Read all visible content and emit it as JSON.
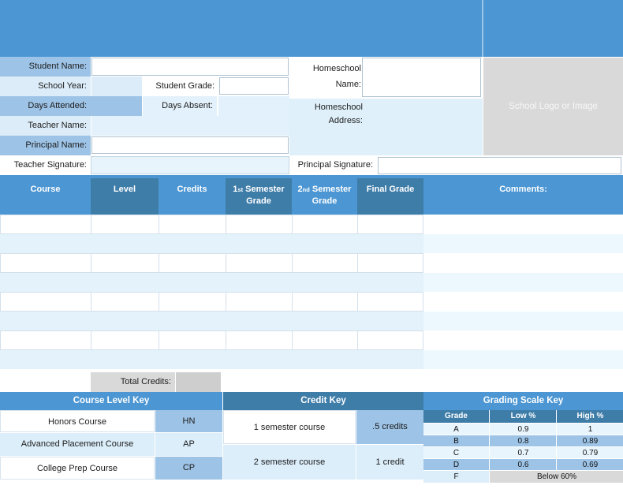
{
  "info": {
    "student_name": {
      "label": "Student Name:",
      "value": ""
    },
    "school_year": {
      "label": "School Year:",
      "value": ""
    },
    "student_grade": {
      "label": "Student Grade:",
      "value": ""
    },
    "days_attended": {
      "label": "Days Attended:",
      "value": ""
    },
    "days_absent": {
      "label": "Days Absent:",
      "value": ""
    },
    "teacher_name": {
      "label": "Teacher Name:",
      "value": ""
    },
    "principal_name": {
      "label": "Principal Name:",
      "value": ""
    },
    "teacher_signature": {
      "label": "Teacher Signature:",
      "value": ""
    },
    "homeschool_name": {
      "label": "Homeschool Name:",
      "value": ""
    },
    "homeschool_address": {
      "label": "Homeschool Address:",
      "value": ""
    },
    "principal_signature": {
      "label": "Principal Signature:",
      "value": ""
    },
    "logo_placeholder": "School Logo or Image"
  },
  "course_table": {
    "headers": {
      "course": "Course",
      "level": "Level",
      "credits": "Credits",
      "sem1": {
        "num": "1",
        "ord": "st",
        "rest": " Semester Grade"
      },
      "sem2": {
        "num": "2",
        "ord": "nd",
        "rest": " Semester Grade"
      },
      "final": "Final Grade",
      "comments": "Comments:"
    },
    "empty_row_count": 8,
    "total_credits": {
      "label": "Total Credits:",
      "value": ""
    }
  },
  "keys": {
    "course_level": {
      "title": "Course Level Key",
      "rows": [
        {
          "name": "Honors Course",
          "code": "HN"
        },
        {
          "name": "Advanced Placement Course",
          "code": "AP"
        },
        {
          "name": "College Prep Course",
          "code": "CP"
        }
      ]
    },
    "credit": {
      "title": "Credit Key",
      "rows": [
        {
          "name": "1 semester course",
          "value": ".5 credits"
        },
        {
          "name": "2 semester course",
          "value": "1 credit"
        }
      ]
    },
    "grading": {
      "title": "Grading Scale Key",
      "columns": [
        "Grade",
        "Low %",
        "High %"
      ],
      "rows": [
        {
          "grade": "A",
          "low": "0.9",
          "high": "1"
        },
        {
          "grade": "B",
          "low": "0.8",
          "high": "0.89"
        },
        {
          "grade": "C",
          "low": "0.7",
          "high": "0.79"
        },
        {
          "grade": "D",
          "low": "0.6",
          "high": "0.69"
        },
        {
          "grade": "F",
          "range": "Below 60%"
        }
      ]
    }
  },
  "colors": {
    "accent_blue": "#4B96D3",
    "accent_dark_blue": "#3F7DA9",
    "label_medium_blue": "#9DC3E6",
    "label_light_blue": "#DCEDF9",
    "row_band_blue": "#E4F2FB",
    "placeholder_gray": "#D9D9D9"
  }
}
